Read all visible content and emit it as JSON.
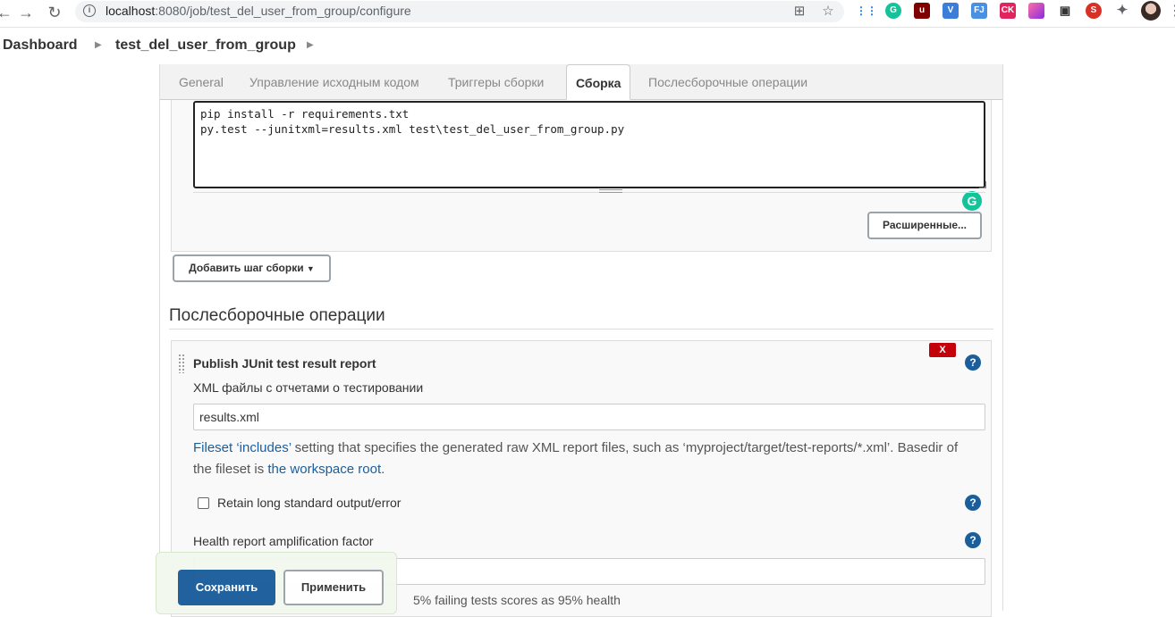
{
  "browser": {
    "url_host": "localhost",
    "url_path": ":8080/job/test_del_user_from_group/configure",
    "icons": [
      "back-icon",
      "forward-icon",
      "reload-icon",
      "translate-icon",
      "star-icon"
    ],
    "extensions": [
      "apps-grid",
      "grammarly",
      "ublock",
      "vimeo",
      "fj",
      "ck",
      "gradient",
      "bus",
      "seo",
      "puzzle"
    ]
  },
  "breadcrumb": {
    "dashboard": "Dashboard",
    "job": "test_del_user_from_group"
  },
  "tabs": [
    {
      "label": "General"
    },
    {
      "label": "Управление исходным кодом"
    },
    {
      "label": "Триггеры сборки"
    },
    {
      "label": "Сборка"
    },
    {
      "label": "Послесборочные операции"
    }
  ],
  "build": {
    "command": "pip install -r requirements.txt\npy.test --junitxml=results.xml test\\test_del_user_from_group.py",
    "advanced_label": "Расширенные...",
    "add_step_label": "Добавить шаг сборки"
  },
  "post_build": {
    "section_title": "Послесборочные операции",
    "publish_title": "Publish JUnit test result report",
    "delete_label": "X",
    "xml_label": "XML файлы с отчетами о тестировании",
    "xml_value": "results.xml",
    "desc_part1": "Fileset ‘includes’",
    "desc_part2": " setting that specifies the generated raw XML report files, such as ‘myproject/target/test-reports/*.xml’. Basedir of the fileset is ",
    "desc_part3": "the workspace root",
    "desc_part4": ".",
    "retain_label": "Retain long standard output/error",
    "health_label": "Health report amplification factor",
    "health_hint": "5% failing tests scores as 95% health",
    "help_glyph": "?"
  },
  "savebar": {
    "save_label": "Сохранить",
    "apply_label": "Применить"
  },
  "colors": {
    "primary": "#1b5e9c",
    "danger": "#c4000a",
    "grammarly": "#15c39a"
  }
}
